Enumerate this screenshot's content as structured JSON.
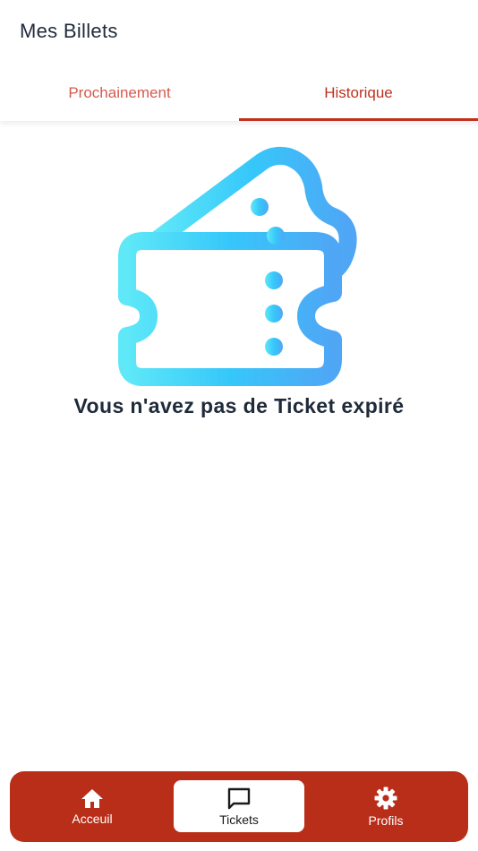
{
  "header": {
    "title": "Mes Billets"
  },
  "tabs": [
    {
      "label": "Prochainement",
      "active": false
    },
    {
      "label": "Historique",
      "active": true
    }
  ],
  "empty_state": {
    "icon": "ticket-icon",
    "message": "Vous n'avez pas de Ticket expiré"
  },
  "bottom_nav": {
    "items": [
      {
        "label": "Acceuil",
        "icon": "home-icon",
        "active": false
      },
      {
        "label": "Tickets",
        "icon": "message-icon",
        "active": true
      },
      {
        "label": "Profils",
        "icon": "gear-icon",
        "active": false
      }
    ]
  },
  "colors": {
    "accent": "#c0311d",
    "nav_background": "#b92e18",
    "text_dark": "#1f2a3a",
    "illustration_start": "#5ee8f8",
    "illustration_end": "#48a8f6"
  }
}
